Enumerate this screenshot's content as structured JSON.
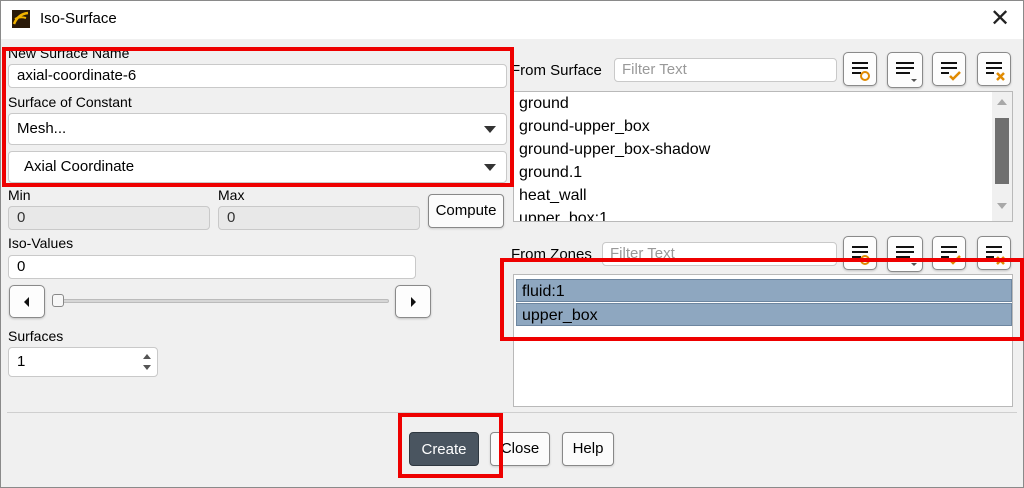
{
  "window": {
    "title": "Iso-Surface",
    "close_glyph": "✕"
  },
  "left": {
    "new_surface_name_label": "New Surface Name",
    "new_surface_name_value": "axial-coordinate-6",
    "surface_of_constant_label": "Surface of Constant",
    "constant_category": "Mesh...",
    "constant_quantity": "Axial Coordinate",
    "min_label": "Min",
    "min_value": "0",
    "max_label": "Max",
    "max_value": "0",
    "compute_label": "Compute",
    "iso_values_label": "Iso-Values",
    "iso_values_value": "0",
    "slider_level": 0,
    "surfaces_label": "Surfaces",
    "surfaces_value": "1"
  },
  "from_surface": {
    "label": "From Surface",
    "filter_placeholder": "Filter Text",
    "items": [
      "ground",
      "ground-upper_box",
      "ground-upper_box-shadow",
      "ground.1",
      "heat_wall",
      "upper_box:1"
    ]
  },
  "from_zones": {
    "label": "From Zones",
    "filter_placeholder": "Filter Text",
    "items": [
      "fluid:1",
      "upper_box"
    ]
  },
  "footer": {
    "create_label": "Create",
    "close_label": "Close",
    "help_label": "Help"
  },
  "colors": {
    "highlight": "#ee0000",
    "selection": "#8ea7c0",
    "primary_button": "#4a5560"
  }
}
